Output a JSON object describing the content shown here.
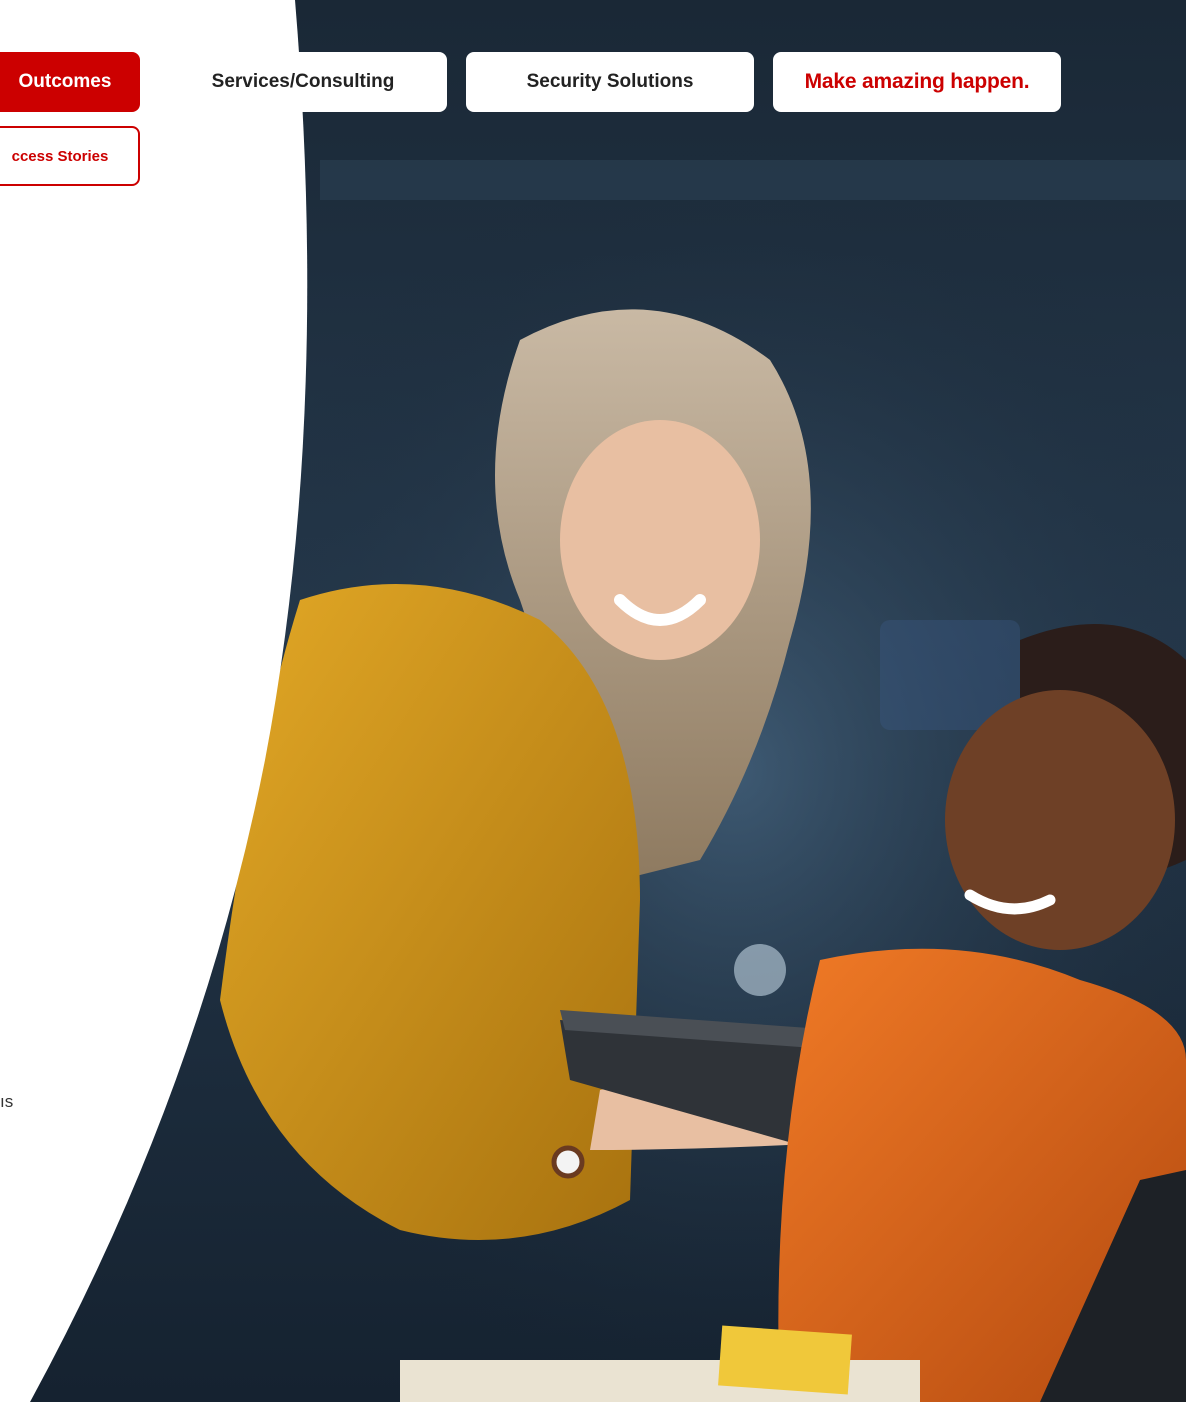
{
  "nav": {
    "outcomes_label": "Outcomes",
    "success_stories_label": "ccess Stories",
    "services_label": "Services/Consulting",
    "security_label": "Security Solutions",
    "tagline_label": "Make amazing happen."
  },
  "left_panel": {
    "fragment_text": "ıs"
  },
  "photo": {
    "icon": "two-women-tablet-photo"
  },
  "colors": {
    "brand_red": "#cc0000",
    "night_blue": "#1b2a3a",
    "mustard": "#d8a01c",
    "orange": "#e0661a"
  }
}
